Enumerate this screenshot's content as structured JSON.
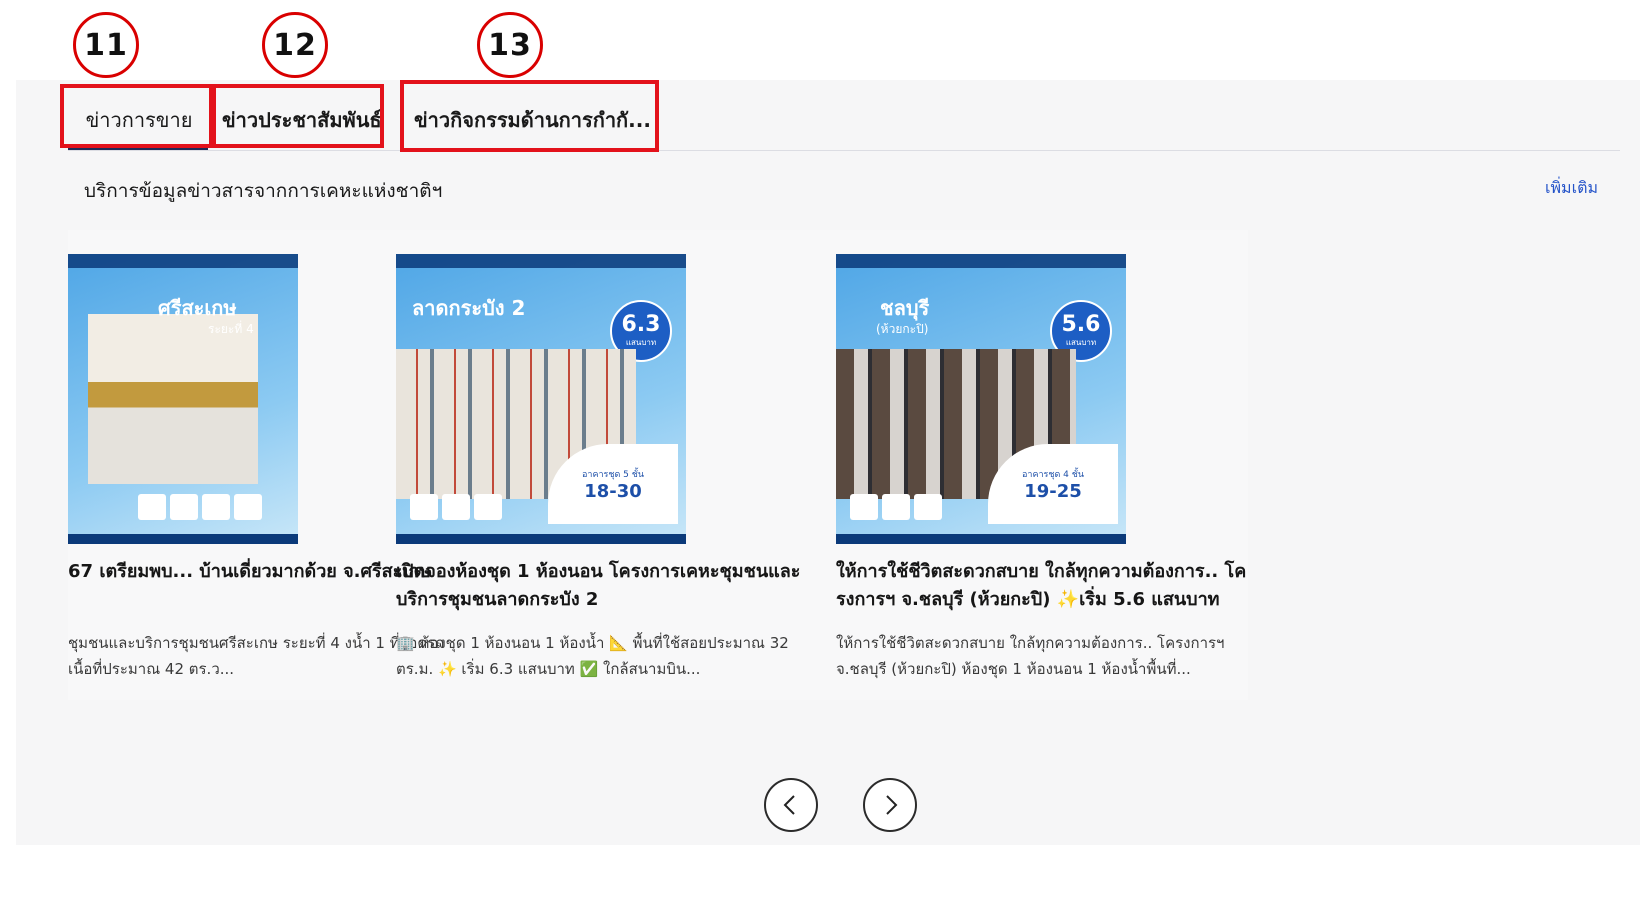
{
  "annotations": {
    "circle_11": "11",
    "circle_12": "12",
    "circle_13": "13"
  },
  "tabs": [
    {
      "label": "ข่าวการขาย"
    },
    {
      "label": "ข่าวประชาสัมพันธ์"
    },
    {
      "label": "ข่าวกิจกรรมด้านการกำกั..."
    }
  ],
  "section": {
    "description": "บริการข้อมูลข่าวสารจากการเคหะแห่งชาติฯ",
    "more_link": "เพิ่มเติม"
  },
  "cards": [
    {
      "title": "67 เตรียมพบ... บ้านเดี่ยวมากด้วย จ.ศรีสะเกษ",
      "excerpt": "ชุมชนและบริการชุมชนศรีสะเกษ ระยะที่ 4 งน้ำ 1 ที่จอดรถ เนื้อที่ประมาณ 42 ตร.ว...",
      "poster": {
        "name": "ศรีสะเกษ",
        "sub": "ระยะที่ 4"
      }
    },
    {
      "title": "เปิดจองห้องชุด 1 ห้องนอน โครงการเคหะชุมชนและบริการชุมชนลาดกระบัง 2",
      "excerpt": "🏢 ห้องชุด 1 ห้องนอน 1 ห้องน้ำ 📐 พื้นที่ใช้สอยประมาณ 32 ตร.ม. ✨ เริ่ม 6.3 แสนบาท ✅ ใกล้สนามบิน...",
      "poster": {
        "name": "ลาดกระบัง 2",
        "price": "6.3",
        "price_unit": "แสนบาท",
        "date": "18-30",
        "date_sub": "อาคารชุด 5 ชั้น"
      }
    },
    {
      "title": "ให้การใช้ชีวิตสะดวกสบาย ใกล้ทุกความต้องการ.. โครงการฯ จ.ชลบุรี (ห้วยกะปิ) ✨เริ่ม 5.6 แสนบาท",
      "excerpt": "ให้การใช้ชีวิตสะดวกสบาย ใกล้ทุกความต้องการ.. โครงการฯ จ.ชลบุรี (ห้วยกะปิ) ห้องชุด 1 ห้องนอน 1 ห้องน้ำพื้นที่...",
      "poster": {
        "name": "ชลบุรี",
        "sub": "(ห้วยกะปิ)",
        "price": "5.6",
        "price_unit": "แสนบาท",
        "date": "19-25",
        "date_sub": "อาคารชุด 4 ชั้น"
      }
    }
  ],
  "colors": {
    "annotation_red": "#e3121b",
    "tab_underline": "#1f2a56",
    "link_blue": "#2453c9",
    "panel_bg": "#f6f6f7"
  }
}
